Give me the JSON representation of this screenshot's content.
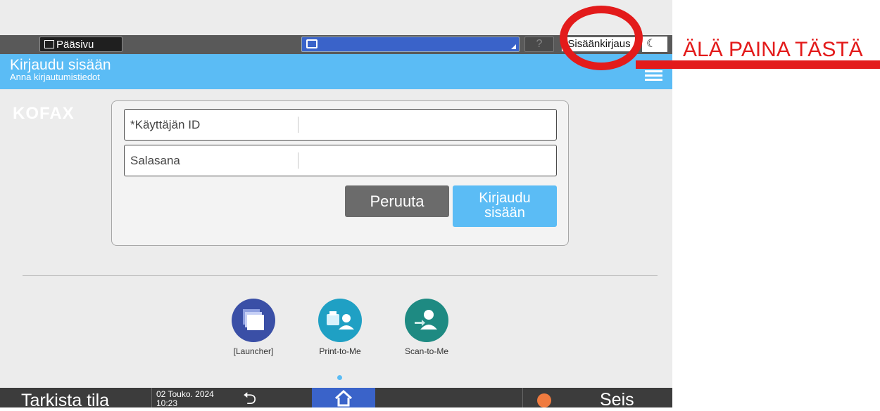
{
  "status_bar": {
    "home_label": "Pääsivu",
    "help_label": "?",
    "login_label": "Sisäänkirjaus"
  },
  "title_bar": {
    "title": "Kirjaudu sisään",
    "subtitle": "Anna kirjautumistiedot"
  },
  "brand": "KOFAX",
  "form": {
    "user_id_label": "*Käyttäjän ID",
    "password_label": "Salasana",
    "cancel_label": "Peruuta",
    "login_label_line1": "Kirjaudu",
    "login_label_line2": "sisään"
  },
  "apps": [
    {
      "label": "[Launcher]",
      "color": "#3a4fa6",
      "icon": "launcher-icon"
    },
    {
      "label": "Print-to-Me",
      "color": "#1fa0c4",
      "icon": "print-to-me-icon"
    },
    {
      "label": "Scan-to-Me",
      "color": "#1e8a82",
      "icon": "scan-to-me-icon"
    }
  ],
  "bottom_bar": {
    "check_status": "Tarkista tila",
    "date": "02 Touko. 2024",
    "time": "10:23",
    "stop": "Seis"
  },
  "annotation": {
    "warning": "ÄLÄ PAINA TÄSTÄ",
    "color": "#e31b1b"
  }
}
